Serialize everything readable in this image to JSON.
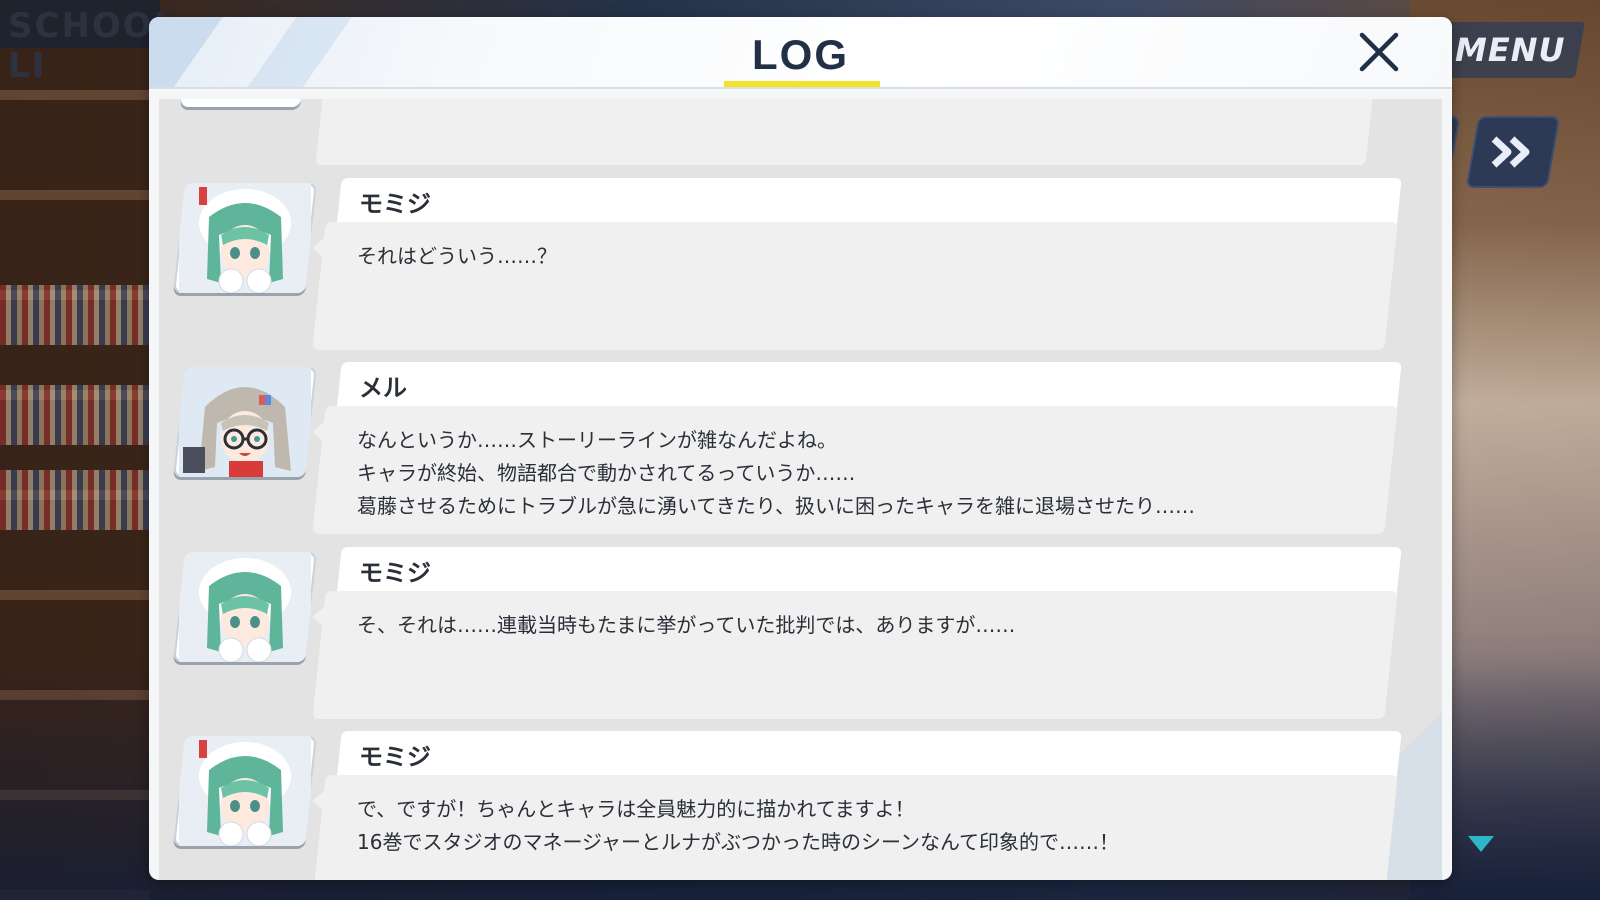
{
  "app": {
    "menu_label": "MENU",
    "bg_sign_text": "SCHOOL LI"
  },
  "log": {
    "title": "LOG",
    "entries": [
      {
        "speaker": "モミジ",
        "avatar": "momiji",
        "lines": [
          "それはどういう……？"
        ]
      },
      {
        "speaker": "メル",
        "avatar": "meru",
        "lines": [
          "なんというか……ストーリーラインが雑なんだよね。",
          "キャラが終始、物語都合で動かされてるっていうか……",
          "葛藤させるためにトラブルが急に湧いてきたり、扱いに困ったキャラを雑に退場させたり……"
        ]
      },
      {
        "speaker": "モミジ",
        "avatar": "momiji",
        "lines": [
          "そ、それは……連載当時もたまに挙がっていた批判では、ありますが……"
        ]
      },
      {
        "speaker": "モミジ",
        "avatar": "momiji",
        "lines": [
          "で、ですが！ちゃんとキャラは全員魅力的に描かれてますよ！",
          "16巻でスタジオのマネージャーとルナがぶつかった時のシーンなんて印象的で……！"
        ]
      }
    ]
  },
  "colors": {
    "title_underline": "#f2e22c",
    "title_text": "#213047",
    "name_bubble": "#ffffff",
    "body_bubble": "#f0f0f0",
    "panel_bg": "#e3e3e3",
    "control_bg": "#2d3a55",
    "scroll_arrow": "#2cb6c8"
  },
  "icons": {
    "close": "close-icon",
    "fast_forward": "fast-forward-icon",
    "scroll_down": "scroll-down-arrow-icon"
  }
}
